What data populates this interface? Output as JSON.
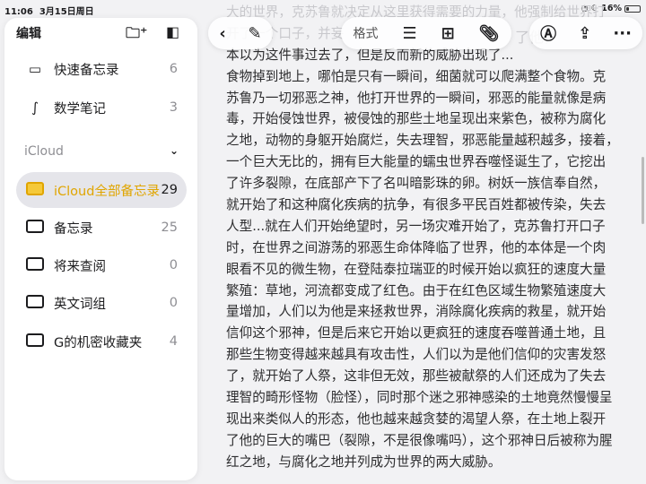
{
  "status": {
    "time": "11:06",
    "date": "3月15日周日",
    "battery": "16%",
    "battery_level": 0.16
  },
  "sidebar": {
    "edit": "编辑",
    "items": [
      {
        "label": "快速备忘录",
        "count": "6"
      },
      {
        "label": "数学笔记",
        "count": "3"
      }
    ],
    "section": "iCloud",
    "folders": [
      {
        "label": "iCloud全部备忘录",
        "count": "29"
      },
      {
        "label": "备忘录",
        "count": "25"
      },
      {
        "label": "将来查阅",
        "count": "0"
      },
      {
        "label": "英文词组",
        "count": "0"
      },
      {
        "label": "G的机密收藏夹",
        "count": "4"
      }
    ]
  },
  "toolbar": {
    "format": "格式"
  },
  "note": {
    "lines": [
      "大的世界，克苏鲁就决定从这里获得需要的力量，他强制给世界打",
      "开了一个口子，并妄",
      "本以为这件事过去了，但是反而新的威胁出现了...",
      "食物掉到地上，哪怕是只有一瞬间，细菌就可以爬满整个食物。克",
      "苏鲁乃一切邪恶之神，他打开世界的一瞬间，邪恶的能量就像是病",
      "毒，开始侵蚀世界，被侵蚀的那些土地呈现出来紫色，被称为腐化",
      "之地，动物的身躯开始腐烂，失去理智，邪恶能量越积越多，接着，",
      "一个巨大无比的，拥有巨大能量的蠕虫世界吞噬怪诞生了，它挖出",
      "了许多裂隙，在底部产下了名叫暗影珠的卵。树妖一族信奉自然，",
      "就开始了和这种腐化疾病的抗争，有很多平民百姓都被传染，失去",
      "人型...就在人们开始绝望时，另一场灾难开始了，克苏鲁打开口子",
      "时，在世界之间游荡的邪恶生命体降临了世界，他的本体是一个肉",
      "眼看不见的微生物，在登陆泰拉瑞亚的时候开始以疯狂的速度大量",
      "繁殖：草地，河流都变成了红色。由于在红色区域生物繁殖速度大",
      "量增加，人们以为他是来拯救世界，消除腐化疾病的救星，就开始",
      "信仰这个邪神，但是后来它开始以更疯狂的速度吞噬普通土地，且",
      "那些生物变得越来越具有攻击性，人们以为是他们信仰的灾害发怒",
      "了，就开始了人祭，这非但无效，那些被献祭的人们还成为了失去",
      "理智的畸形怪物（脸怪），同时那个迷之邪神感染的土地竟然慢慢呈",
      "现出来类似人的形态，他也越来越贪婪的渴望人祭，在土地上裂开",
      "了他的巨大的嘴巴（裂隙，不是很像嘴吗），这个邪神日后被称为腥",
      "红之地，与腐化之地并列成为世界的两大威胁。"
    ],
    "hidden_fragment": "了他，"
  },
  "colors": {
    "accent": "#e0a500"
  }
}
